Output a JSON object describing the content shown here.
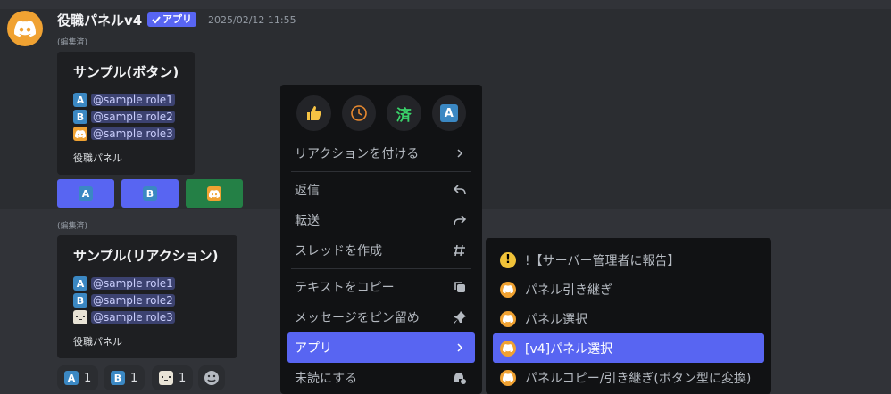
{
  "message": {
    "username": "役職パネルv4",
    "app_badge": "アプリ",
    "timestamp": "2025/02/12 11:55",
    "edited": "(編集済)"
  },
  "embed1": {
    "title": "サンプル(ボタン)",
    "roles": [
      "@sample role1",
      "@sample role2",
      "@sample role3"
    ],
    "footer": "役職パネル"
  },
  "embed2": {
    "title": "サンプル(リアクション)",
    "roles": [
      "@sample role1",
      "@sample role2",
      "@sample role3"
    ],
    "footer": "役職パネル"
  },
  "emoji_letters": {
    "a": "A",
    "b": "B"
  },
  "reactions": [
    {
      "emoji": "regional-a",
      "count": "1"
    },
    {
      "emoji": "regional-b",
      "count": "1"
    },
    {
      "emoji": "face",
      "count": "1"
    }
  ],
  "context_menu": {
    "quick_reactions": [
      "thumbs-up",
      "clock",
      "済",
      "A"
    ],
    "items": {
      "add_reaction": "リアクションを付ける",
      "reply": "返信",
      "forward": "転送",
      "create_thread": "スレッドを作成",
      "copy_text": "テキストをコピー",
      "pin": "メッセージをピン留め",
      "apps": "アプリ",
      "mark_unread": "未読にする"
    }
  },
  "apps_submenu": {
    "items": [
      "!【サーバー管理者に報告】",
      "パネル引き継ぎ",
      "パネル選択",
      "[v4]パネル選択",
      "パネルコピー/引き継ぎ(ボタン型に変換)"
    ]
  },
  "colors": {
    "blurple": "#5865f2",
    "green": "#248046",
    "discord_orange": "#f0a232"
  }
}
